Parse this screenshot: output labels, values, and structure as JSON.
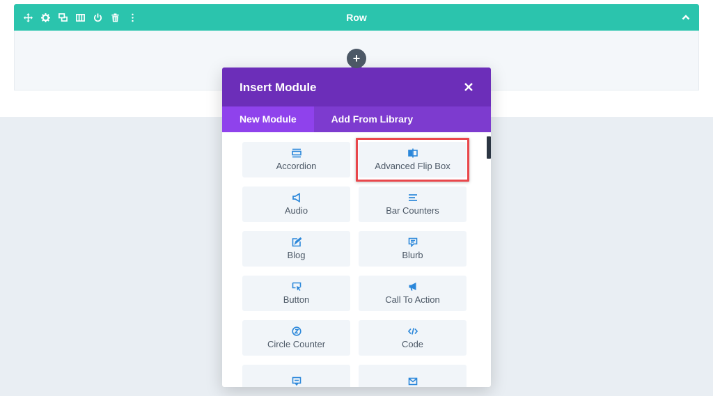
{
  "row": {
    "title": "Row",
    "tools": [
      {
        "icon": "move-icon",
        "label": "Move"
      },
      {
        "icon": "gear-icon",
        "label": "Settings"
      },
      {
        "icon": "duplicate-icon",
        "label": "Duplicate"
      },
      {
        "icon": "columns-icon",
        "label": "Columns"
      },
      {
        "icon": "power-icon",
        "label": "Disable"
      },
      {
        "icon": "trash-icon",
        "label": "Delete"
      },
      {
        "icon": "more-icon",
        "label": "More"
      }
    ],
    "collapse_icon": "chevron-up-icon",
    "add_module_label": "+"
  },
  "modal": {
    "title": "Insert Module",
    "close_icon": "close-icon",
    "tabs": [
      {
        "label": "New Module",
        "active": true
      },
      {
        "label": "Add From Library",
        "active": false
      }
    ],
    "modules": [
      {
        "label": "Accordion",
        "icon": "accordion-icon"
      },
      {
        "label": "Advanced Flip Box",
        "icon": "flip-box-icon",
        "highlighted": true
      },
      {
        "label": "Audio",
        "icon": "audio-icon"
      },
      {
        "label": "Bar Counters",
        "icon": "bar-counters-icon"
      },
      {
        "label": "Blog",
        "icon": "blog-icon"
      },
      {
        "label": "Blurb",
        "icon": "blurb-icon"
      },
      {
        "label": "Button",
        "icon": "button-icon"
      },
      {
        "label": "Call To Action",
        "icon": "call-to-action-icon"
      },
      {
        "label": "Circle Counter",
        "icon": "circle-counter-icon"
      },
      {
        "label": "Code",
        "icon": "code-icon"
      },
      {
        "label": "",
        "icon": "comments-icon"
      },
      {
        "label": "",
        "icon": "contact-form-icon"
      }
    ]
  },
  "colors": {
    "row_accent": "#2bc4ad",
    "modal_header": "#6c2eb9",
    "modal_tabs": "#7d3bcf",
    "active_tab": "#8f42ec",
    "module_icon": "#2b87da",
    "highlight": "#e9474b"
  }
}
